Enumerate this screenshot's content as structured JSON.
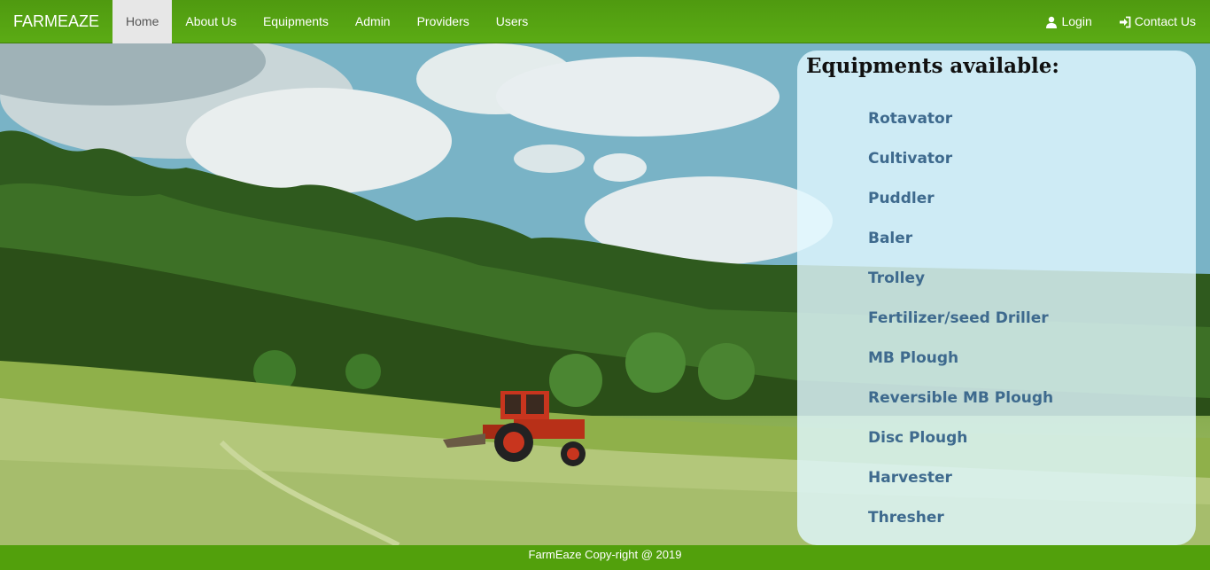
{
  "navbar": {
    "brand": "FARMEAZE",
    "items": [
      {
        "label": "Home",
        "active": true
      },
      {
        "label": "About Us"
      },
      {
        "label": "Equipments"
      },
      {
        "label": "Admin"
      },
      {
        "label": "Providers"
      },
      {
        "label": "Users"
      }
    ],
    "right": {
      "login": {
        "label": "Login",
        "icon": "user-icon"
      },
      "contact": {
        "label": "Contact Us",
        "icon": "login-arrow-icon"
      }
    }
  },
  "panel": {
    "title": "Equipments available:",
    "items": [
      "Rotavator",
      "Cultivator",
      "Puddler",
      "Baler",
      "Trolley",
      "Fertilizer/seed Driller",
      "MB Plough",
      "Reversible MB Plough",
      "Disc Plough",
      "Harvester",
      "Thresher"
    ]
  },
  "footer": {
    "text": "FarmEaze Copy-right @ 2019"
  },
  "colors": {
    "nav_green": "#5bab14",
    "footer_green": "#52a00c",
    "panel_bg": "#e0f8ff",
    "item_text": "#3e6a8e"
  }
}
